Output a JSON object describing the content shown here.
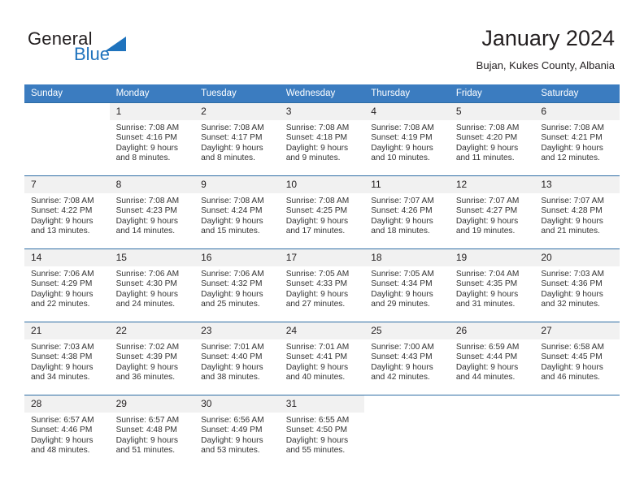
{
  "brand": {
    "name_part1": "General",
    "name_part2": "Blue",
    "logo_icon": "triangle-flag-icon",
    "accent_color": "#1f73bd"
  },
  "header": {
    "title": "January 2024",
    "subtitle": "Bujan, Kukes County, Albania"
  },
  "calendar": {
    "header_bg": "#3b7cc0",
    "daynum_bg": "#f1f1f1",
    "row_border_color": "#2e6da4",
    "weekday_headers": [
      "Sunday",
      "Monday",
      "Tuesday",
      "Wednesday",
      "Thursday",
      "Friday",
      "Saturday"
    ],
    "weeks": [
      [
        {
          "day": "",
          "sunrise": "",
          "sunset": "",
          "daylight_line1": "",
          "daylight_line2": ""
        },
        {
          "day": "1",
          "sunrise": "Sunrise: 7:08 AM",
          "sunset": "Sunset: 4:16 PM",
          "daylight_line1": "Daylight: 9 hours",
          "daylight_line2": "and 8 minutes."
        },
        {
          "day": "2",
          "sunrise": "Sunrise: 7:08 AM",
          "sunset": "Sunset: 4:17 PM",
          "daylight_line1": "Daylight: 9 hours",
          "daylight_line2": "and 8 minutes."
        },
        {
          "day": "3",
          "sunrise": "Sunrise: 7:08 AM",
          "sunset": "Sunset: 4:18 PM",
          "daylight_line1": "Daylight: 9 hours",
          "daylight_line2": "and 9 minutes."
        },
        {
          "day": "4",
          "sunrise": "Sunrise: 7:08 AM",
          "sunset": "Sunset: 4:19 PM",
          "daylight_line1": "Daylight: 9 hours",
          "daylight_line2": "and 10 minutes."
        },
        {
          "day": "5",
          "sunrise": "Sunrise: 7:08 AM",
          "sunset": "Sunset: 4:20 PM",
          "daylight_line1": "Daylight: 9 hours",
          "daylight_line2": "and 11 minutes."
        },
        {
          "day": "6",
          "sunrise": "Sunrise: 7:08 AM",
          "sunset": "Sunset: 4:21 PM",
          "daylight_line1": "Daylight: 9 hours",
          "daylight_line2": "and 12 minutes."
        }
      ],
      [
        {
          "day": "7",
          "sunrise": "Sunrise: 7:08 AM",
          "sunset": "Sunset: 4:22 PM",
          "daylight_line1": "Daylight: 9 hours",
          "daylight_line2": "and 13 minutes."
        },
        {
          "day": "8",
          "sunrise": "Sunrise: 7:08 AM",
          "sunset": "Sunset: 4:23 PM",
          "daylight_line1": "Daylight: 9 hours",
          "daylight_line2": "and 14 minutes."
        },
        {
          "day": "9",
          "sunrise": "Sunrise: 7:08 AM",
          "sunset": "Sunset: 4:24 PM",
          "daylight_line1": "Daylight: 9 hours",
          "daylight_line2": "and 15 minutes."
        },
        {
          "day": "10",
          "sunrise": "Sunrise: 7:08 AM",
          "sunset": "Sunset: 4:25 PM",
          "daylight_line1": "Daylight: 9 hours",
          "daylight_line2": "and 17 minutes."
        },
        {
          "day": "11",
          "sunrise": "Sunrise: 7:07 AM",
          "sunset": "Sunset: 4:26 PM",
          "daylight_line1": "Daylight: 9 hours",
          "daylight_line2": "and 18 minutes."
        },
        {
          "day": "12",
          "sunrise": "Sunrise: 7:07 AM",
          "sunset": "Sunset: 4:27 PM",
          "daylight_line1": "Daylight: 9 hours",
          "daylight_line2": "and 19 minutes."
        },
        {
          "day": "13",
          "sunrise": "Sunrise: 7:07 AM",
          "sunset": "Sunset: 4:28 PM",
          "daylight_line1": "Daylight: 9 hours",
          "daylight_line2": "and 21 minutes."
        }
      ],
      [
        {
          "day": "14",
          "sunrise": "Sunrise: 7:06 AM",
          "sunset": "Sunset: 4:29 PM",
          "daylight_line1": "Daylight: 9 hours",
          "daylight_line2": "and 22 minutes."
        },
        {
          "day": "15",
          "sunrise": "Sunrise: 7:06 AM",
          "sunset": "Sunset: 4:30 PM",
          "daylight_line1": "Daylight: 9 hours",
          "daylight_line2": "and 24 minutes."
        },
        {
          "day": "16",
          "sunrise": "Sunrise: 7:06 AM",
          "sunset": "Sunset: 4:32 PM",
          "daylight_line1": "Daylight: 9 hours",
          "daylight_line2": "and 25 minutes."
        },
        {
          "day": "17",
          "sunrise": "Sunrise: 7:05 AM",
          "sunset": "Sunset: 4:33 PM",
          "daylight_line1": "Daylight: 9 hours",
          "daylight_line2": "and 27 minutes."
        },
        {
          "day": "18",
          "sunrise": "Sunrise: 7:05 AM",
          "sunset": "Sunset: 4:34 PM",
          "daylight_line1": "Daylight: 9 hours",
          "daylight_line2": "and 29 minutes."
        },
        {
          "day": "19",
          "sunrise": "Sunrise: 7:04 AM",
          "sunset": "Sunset: 4:35 PM",
          "daylight_line1": "Daylight: 9 hours",
          "daylight_line2": "and 31 minutes."
        },
        {
          "day": "20",
          "sunrise": "Sunrise: 7:03 AM",
          "sunset": "Sunset: 4:36 PM",
          "daylight_line1": "Daylight: 9 hours",
          "daylight_line2": "and 32 minutes."
        }
      ],
      [
        {
          "day": "21",
          "sunrise": "Sunrise: 7:03 AM",
          "sunset": "Sunset: 4:38 PM",
          "daylight_line1": "Daylight: 9 hours",
          "daylight_line2": "and 34 minutes."
        },
        {
          "day": "22",
          "sunrise": "Sunrise: 7:02 AM",
          "sunset": "Sunset: 4:39 PM",
          "daylight_line1": "Daylight: 9 hours",
          "daylight_line2": "and 36 minutes."
        },
        {
          "day": "23",
          "sunrise": "Sunrise: 7:01 AM",
          "sunset": "Sunset: 4:40 PM",
          "daylight_line1": "Daylight: 9 hours",
          "daylight_line2": "and 38 minutes."
        },
        {
          "day": "24",
          "sunrise": "Sunrise: 7:01 AM",
          "sunset": "Sunset: 4:41 PM",
          "daylight_line1": "Daylight: 9 hours",
          "daylight_line2": "and 40 minutes."
        },
        {
          "day": "25",
          "sunrise": "Sunrise: 7:00 AM",
          "sunset": "Sunset: 4:43 PM",
          "daylight_line1": "Daylight: 9 hours",
          "daylight_line2": "and 42 minutes."
        },
        {
          "day": "26",
          "sunrise": "Sunrise: 6:59 AM",
          "sunset": "Sunset: 4:44 PM",
          "daylight_line1": "Daylight: 9 hours",
          "daylight_line2": "and 44 minutes."
        },
        {
          "day": "27",
          "sunrise": "Sunrise: 6:58 AM",
          "sunset": "Sunset: 4:45 PM",
          "daylight_line1": "Daylight: 9 hours",
          "daylight_line2": "and 46 minutes."
        }
      ],
      [
        {
          "day": "28",
          "sunrise": "Sunrise: 6:57 AM",
          "sunset": "Sunset: 4:46 PM",
          "daylight_line1": "Daylight: 9 hours",
          "daylight_line2": "and 48 minutes."
        },
        {
          "day": "29",
          "sunrise": "Sunrise: 6:57 AM",
          "sunset": "Sunset: 4:48 PM",
          "daylight_line1": "Daylight: 9 hours",
          "daylight_line2": "and 51 minutes."
        },
        {
          "day": "30",
          "sunrise": "Sunrise: 6:56 AM",
          "sunset": "Sunset: 4:49 PM",
          "daylight_line1": "Daylight: 9 hours",
          "daylight_line2": "and 53 minutes."
        },
        {
          "day": "31",
          "sunrise": "Sunrise: 6:55 AM",
          "sunset": "Sunset: 4:50 PM",
          "daylight_line1": "Daylight: 9 hours",
          "daylight_line2": "and 55 minutes."
        },
        {
          "day": "",
          "sunrise": "",
          "sunset": "",
          "daylight_line1": "",
          "daylight_line2": ""
        },
        {
          "day": "",
          "sunrise": "",
          "sunset": "",
          "daylight_line1": "",
          "daylight_line2": ""
        },
        {
          "day": "",
          "sunrise": "",
          "sunset": "",
          "daylight_line1": "",
          "daylight_line2": ""
        }
      ]
    ]
  }
}
